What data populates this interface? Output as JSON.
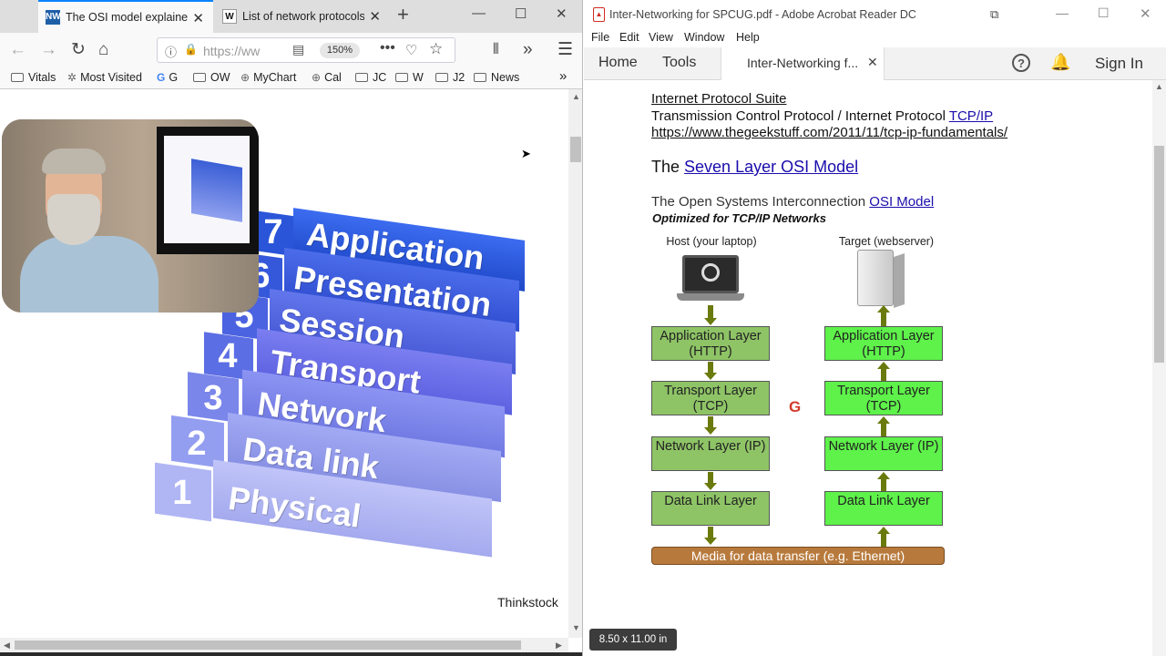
{
  "firefox": {
    "tabs": [
      {
        "label": "The OSI model explained",
        "favicon": "NW"
      },
      {
        "label": "List of network protocols",
        "favicon": "W"
      }
    ],
    "new_tab": "+",
    "url_placeholder": "https://ww",
    "zoom": "150%",
    "bookmarks": [
      {
        "label": "Vitals",
        "icon": "folder-icon"
      },
      {
        "label": "Most Visited",
        "icon": "gear-icon"
      },
      {
        "label": "G",
        "icon": "google-icon"
      },
      {
        "label": "OW",
        "icon": "folder-icon"
      },
      {
        "label": "MyChart",
        "icon": "globe-icon"
      },
      {
        "label": "Cal",
        "icon": "globe-icon"
      },
      {
        "label": "JC",
        "icon": "folder-icon"
      },
      {
        "label": "W",
        "icon": "folder-icon"
      },
      {
        "label": "J2",
        "icon": "folder-icon"
      },
      {
        "label": "News",
        "icon": "folder-icon"
      }
    ],
    "osi_layers": [
      {
        "num": "7",
        "name": "Application"
      },
      {
        "num": "6",
        "name": "Presentation"
      },
      {
        "num": "5",
        "name": "Session"
      },
      {
        "num": "4",
        "name": "Transport"
      },
      {
        "num": "3",
        "name": "Network"
      },
      {
        "num": "2",
        "name": "Data link"
      },
      {
        "num": "1",
        "name": "Physical"
      }
    ],
    "image_credit": "Thinkstock"
  },
  "acrobat": {
    "window_title": "Inter-Networking for SPCUG.pdf - Adobe Acrobat Reader DC",
    "menu": [
      "File",
      "Edit",
      "View",
      "Window",
      "Help"
    ],
    "toolbar": {
      "home": "Home",
      "tools": "Tools",
      "doc_tab": "Inter-Networking f...",
      "sign_in": "Sign In"
    },
    "doc": {
      "link_suite": "Internet Protocol Suite",
      "tcp_line_prefix": "Transmission Control Protocol / Internet Protocol ",
      "tcp_link": "TCP/IP",
      "url": "https://www.thegeekstuff.com/2011/11/tcp-ip-fundamentals/",
      "seven_prefix": "The ",
      "seven_link": "Seven Layer OSI Model",
      "osi_prefix": "The Open Systems Interconnection ",
      "osi_link": "OSI Model",
      "optimized": "Optimized for TCP/IP Networks",
      "host_label": "Host (your laptop)",
      "target_label": "Target (webserver)",
      "layers": [
        "Application Layer (HTTP)",
        "Transport Layer (TCP)",
        "Network Layer (IP)",
        "Data Link Layer"
      ],
      "media": "Media for data transfer (e.g. Ethernet)"
    },
    "page_size": "8.50 x 11.00 in"
  }
}
